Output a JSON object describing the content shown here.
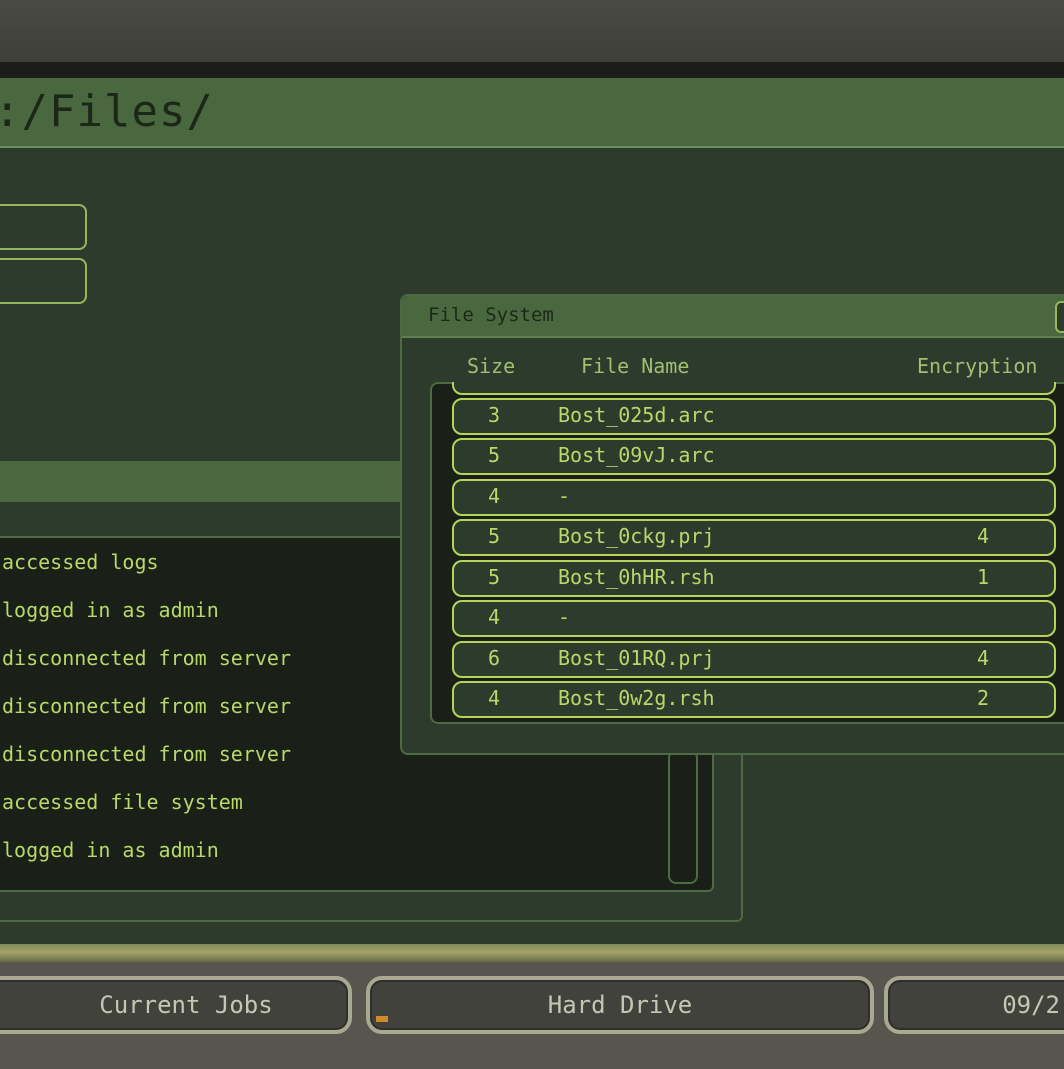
{
  "header": {
    "path_title": ":/Files/"
  },
  "logs": {
    "entries": [
      "accessed logs",
      "logged in as admin",
      "disconnected from server",
      "disconnected from server",
      "disconnected from server",
      "accessed file system",
      "logged in as admin"
    ]
  },
  "file_system": {
    "title": "File System",
    "columns": {
      "size": "Size",
      "file_name": "File Name",
      "encryption": "Encryption"
    },
    "rows": [
      {
        "size": "3",
        "name": "Bost_025d.arc",
        "encryption": ""
      },
      {
        "size": "5",
        "name": "Bost_09vJ.arc",
        "encryption": ""
      },
      {
        "size": "4",
        "name": "-",
        "encryption": ""
      },
      {
        "size": "5",
        "name": "Bost_0ckg.prj",
        "encryption": "4"
      },
      {
        "size": "5",
        "name": "Bost_0hHR.rsh",
        "encryption": "1"
      },
      {
        "size": "4",
        "name": "-",
        "encryption": ""
      },
      {
        "size": "6",
        "name": "Bost_01RQ.prj",
        "encryption": "4"
      },
      {
        "size": "4",
        "name": "Bost_0w2g.rsh",
        "encryption": "2"
      }
    ]
  },
  "taskbar": {
    "current_jobs": "Current Jobs",
    "hard_drive": "Hard Drive",
    "date_partial": "09/2"
  },
  "colors": {
    "accent_green": "#b8d86a",
    "panel_green": "#4a6840",
    "background": "#2c3b2b"
  }
}
